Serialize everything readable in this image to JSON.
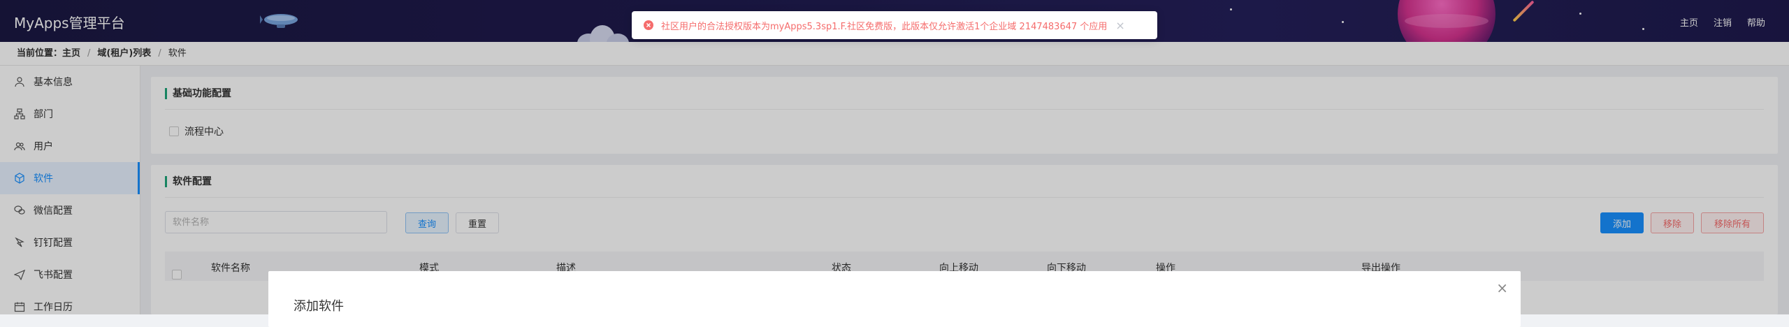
{
  "header": {
    "title": "MyApps管理平台",
    "nav": [
      "主页",
      "注销",
      "帮助"
    ]
  },
  "breadcrumb": {
    "prefix": "当前位置：",
    "items": [
      "主页",
      "域(租户)列表",
      "软件"
    ]
  },
  "sidebar": {
    "items": [
      {
        "label": "基本信息",
        "icon": "user-icon"
      },
      {
        "label": "部门",
        "icon": "org-icon"
      },
      {
        "label": "用户",
        "icon": "users-icon"
      },
      {
        "label": "软件",
        "icon": "box-icon",
        "active": true
      },
      {
        "label": "微信配置",
        "icon": "wechat-icon"
      },
      {
        "label": "钉钉配置",
        "icon": "dingtalk-icon"
      },
      {
        "label": "飞书配置",
        "icon": "feishu-icon"
      },
      {
        "label": "工作日历",
        "icon": "calendar-icon"
      }
    ]
  },
  "basic": {
    "title": "基础功能配置",
    "checkbox_label": "流程中心"
  },
  "software": {
    "title": "软件配置",
    "search_placeholder": "软件名称",
    "query_label": "查询",
    "reset_label": "重置",
    "add_label": "添加",
    "remove_label": "移除",
    "remove_all_label": "移除所有",
    "columns": [
      "软件名称",
      "模式",
      "描述",
      "状态",
      "向上移动",
      "向下移动",
      "操作",
      "导出操作"
    ]
  },
  "modal": {
    "title": "添加软件",
    "close": "×"
  },
  "toast": {
    "message": "社区用户的合法授权版本为myApps5.3sp1.F.社区免费版，此版本仅允许激活1个企业域 2147483647 个应用",
    "close": "×"
  },
  "colors": {
    "accent": "#1890ff",
    "danger": "#f56c6c",
    "section_bar": "#1fa67a",
    "header_bg": "#1b1843"
  }
}
